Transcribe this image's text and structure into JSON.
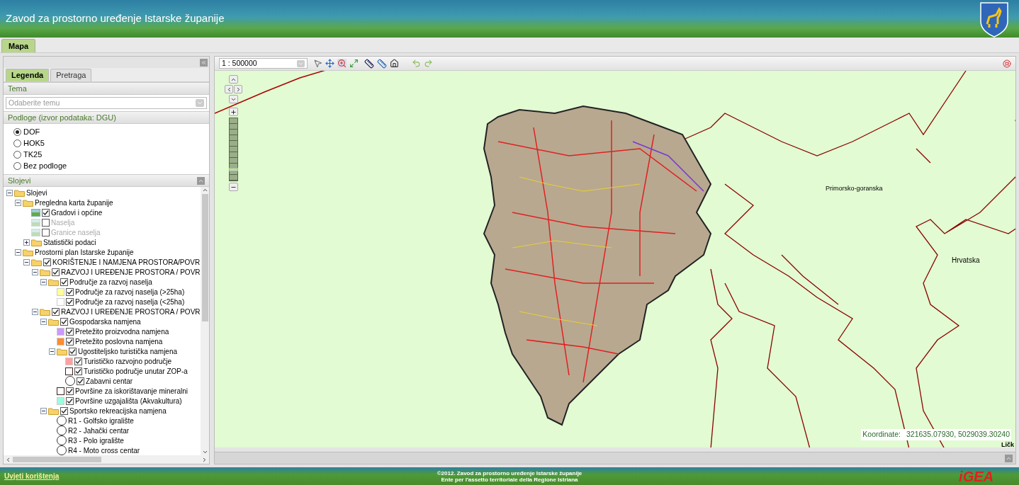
{
  "header": {
    "title": "Zavod za prostorno uređenje Istarske županije"
  },
  "main_tabs": [
    {
      "label": "Mapa",
      "selected": true
    }
  ],
  "left_panel": {
    "tabs": [
      {
        "label": "Legenda",
        "selected": true
      },
      {
        "label": "Pretraga",
        "selected": false
      }
    ],
    "theme": {
      "heading": "Tema",
      "placeholder": "Odaberite temu"
    },
    "basemaps": {
      "heading": "Podloge (izvor podataka: DGU)",
      "options": [
        {
          "label": "DOF",
          "selected": true
        },
        {
          "label": "HOK5",
          "selected": false
        },
        {
          "label": "TK25",
          "selected": false
        },
        {
          "label": "Bez podloge",
          "selected": false
        }
      ]
    },
    "layers": {
      "heading": "Slojevi",
      "tree": [
        {
          "label": "Slojevi",
          "kind": "folder",
          "expanded": true,
          "children": [
            {
              "label": "Pregledna karta županije",
              "kind": "folder",
              "expanded": true,
              "children": [
                {
                  "label": "Gradovi i općine",
                  "kind": "image",
                  "checked": true,
                  "disabled": false
                },
                {
                  "label": "Naselja",
                  "kind": "image",
                  "checked": false,
                  "disabled": true
                },
                {
                  "label": "Granice naselja",
                  "kind": "image",
                  "checked": false,
                  "disabled": true
                },
                {
                  "label": "Statistički podaci",
                  "kind": "folder",
                  "expanded": false
                }
              ]
            },
            {
              "label": "Prostorni plan Istarske županije",
              "kind": "folder",
              "expanded": true,
              "children": [
                {
                  "label": "KORIŠTENJE I NAMJENA PROSTORA/POVR",
                  "kind": "folder",
                  "expanded": true,
                  "checked": true,
                  "children": [
                    {
                      "label": "RAZVOJ I UREĐENJE PROSTORA / POVR",
                      "kind": "folder",
                      "expanded": true,
                      "checked": true,
                      "children": [
                        {
                          "label": "Područje za razvoj naselja",
                          "kind": "folder",
                          "expanded": true,
                          "checked": true,
                          "children": [
                            {
                              "label": "Područje za razvoj naselja (>25ha)",
                              "kind": "swatch",
                              "color": "#ffff99",
                              "checked": true
                            },
                            {
                              "label": "Područje za razvoj naselja (<25ha)",
                              "kind": "swatch",
                              "color": "#ffffff",
                              "checked": true
                            }
                          ]
                        }
                      ]
                    },
                    {
                      "label": "RAZVOJ I UREĐENJE PROSTORA / POVR",
                      "kind": "folder",
                      "expanded": true,
                      "checked": true,
                      "children": [
                        {
                          "label": "Gospodarska namjena",
                          "kind": "folder",
                          "expanded": true,
                          "checked": true,
                          "children": [
                            {
                              "label": "Pretežito proizvodna namjena",
                              "kind": "swatch",
                              "color": "#cc99ff",
                              "checked": true
                            },
                            {
                              "label": "Pretežito poslovna namjena",
                              "kind": "swatch",
                              "color": "#ff8c2e",
                              "checked": true
                            },
                            {
                              "label": "Ugostiteljsko turistička namjena",
                              "kind": "folder",
                              "expanded": true,
                              "checked": true,
                              "children": [
                                {
                                  "label": "Turističko razvojno područje",
                                  "kind": "swatch",
                                  "color": "#ffa0a0",
                                  "checked": true
                                },
                                {
                                  "label": "Turističko područje unutar ZOP-a",
                                  "kind": "outline",
                                  "checked": true
                                },
                                {
                                  "label": "Zabavni centar",
                                  "kind": "circle",
                                  "checked": true
                                }
                              ]
                            },
                            {
                              "label": "Površine za iskorištavanje mineralni",
                              "kind": "outline",
                              "checked": true
                            },
                            {
                              "label": "Površine uzgajališta (Akvakultura)",
                              "kind": "swatch",
                              "color": "#99ffe0",
                              "checked": true
                            }
                          ]
                        },
                        {
                          "label": "Sportsko rekreacijska namjena",
                          "kind": "folder",
                          "expanded": true,
                          "checked": true,
                          "children": [
                            {
                              "label": "R1 - Golfsko igralište",
                              "kind": "circle"
                            },
                            {
                              "label": "R2 - Jahački centar",
                              "kind": "circle"
                            },
                            {
                              "label": "R3 - Polo igralište",
                              "kind": "circle"
                            },
                            {
                              "label": "R4 - Moto cross centar",
                              "kind": "circle"
                            }
                          ]
                        }
                      ]
                    }
                  ]
                }
              ]
            }
          ]
        }
      ]
    }
  },
  "map": {
    "scale": "1 : 500000",
    "zoom": {
      "level": 0.15
    },
    "labels": [
      {
        "text": "Primorsko-goranska"
      },
      {
        "text": "Hrvatska"
      },
      {
        "text": "Ličk"
      }
    ],
    "coordinates": {
      "label": "Koordinate:",
      "value": "321635.07930, 5029039.30240"
    }
  },
  "footer": {
    "link": "Uvjeti korištenja",
    "copyright": [
      "©2012. Zavod za prostorno uređenje Istarske županije",
      "Ente per l'assetto territoriale della Regione Istriana"
    ],
    "logo": "iGEA"
  }
}
